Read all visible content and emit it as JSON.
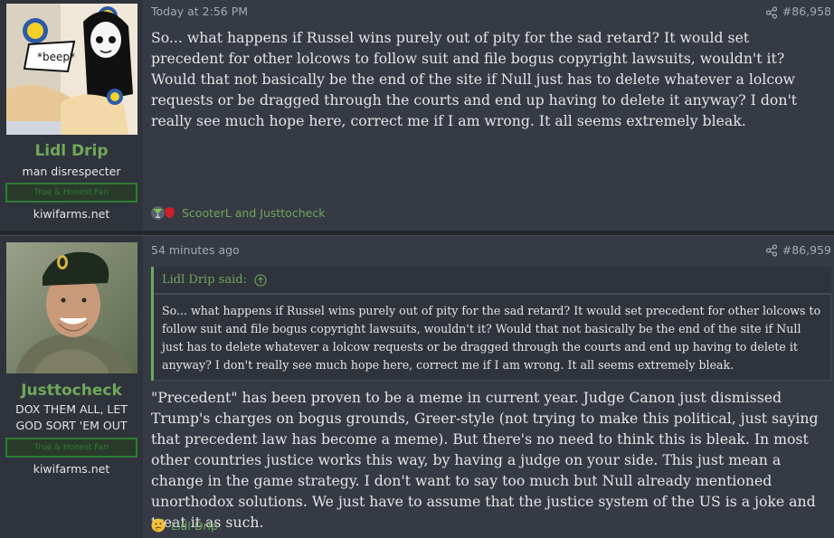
{
  "posts": [
    {
      "author": "Lidl Drip",
      "user_title": "man disrespecter",
      "banner": "True & Honest Fan",
      "site": "kiwifarms.net",
      "avatar_text": "*beep*",
      "timestamp": "Today at 2:56 PM",
      "post_number": "#86,958",
      "body": "So... what happens if Russel wins purely out of pity for the sad retard? It would set precedent for other lolcows to follow suit and file bogus copyright lawsuits, wouldn't it? Would that not basically be the end of the site if Null just has to delete whatever a lolcow requests or be dragged through the courts and end up having to delete it anyway? I don't really see much hope here, correct me if I am wrong. It all seems extremely bleak.",
      "reaction_names": "ScooterL and Justtocheck"
    },
    {
      "author": "Justtocheck",
      "user_title": "DOX THEM ALL, LET GOD SORT 'EM OUT",
      "banner": "True & Honest Fan",
      "site": "kiwifarms.net",
      "timestamp": "54 minutes ago",
      "post_number": "#86,959",
      "quote_author": "Lidl Drip said:",
      "quote_body": "So... what happens if Russel wins purely out of pity for the sad retard? It would set precedent for other lolcows to follow suit and file bogus copyright lawsuits, wouldn't it? Would that not basically be the end of the site if Null just has to delete whatever a lolcow requests or be dragged through the courts and end up having to delete it anyway? I don't really see much hope here, correct me if I am wrong. It all seems extremely bleak.",
      "body": "\"Precedent\" has been proven to be a meme in current year. Judge Canon just dismissed Trump's charges on bogus grounds, Greer-style (not trying to make this political, just saying that precedent law has become a meme). But there's no need to think this is bleak. In most other countries justice works this way, by having a judge on your side. This just mean a change in the game strategy. I don't want to say too much but Null already mentioned unorthodox solutions. We just have to assume that the justice system of the US is a joke and treat it as such.",
      "reaction_names": "Lidl Drip"
    }
  ],
  "colors": {
    "accent_green": "#6fa85a",
    "banner_green": "#2e7d32",
    "background": "#353a44",
    "user_cell": "#2f333c"
  },
  "icons": [
    "share-icon",
    "cocktail-reaction-icon",
    "shield-reaction-icon",
    "thinking-reaction-icon",
    "arrow-up-circle-icon"
  ]
}
